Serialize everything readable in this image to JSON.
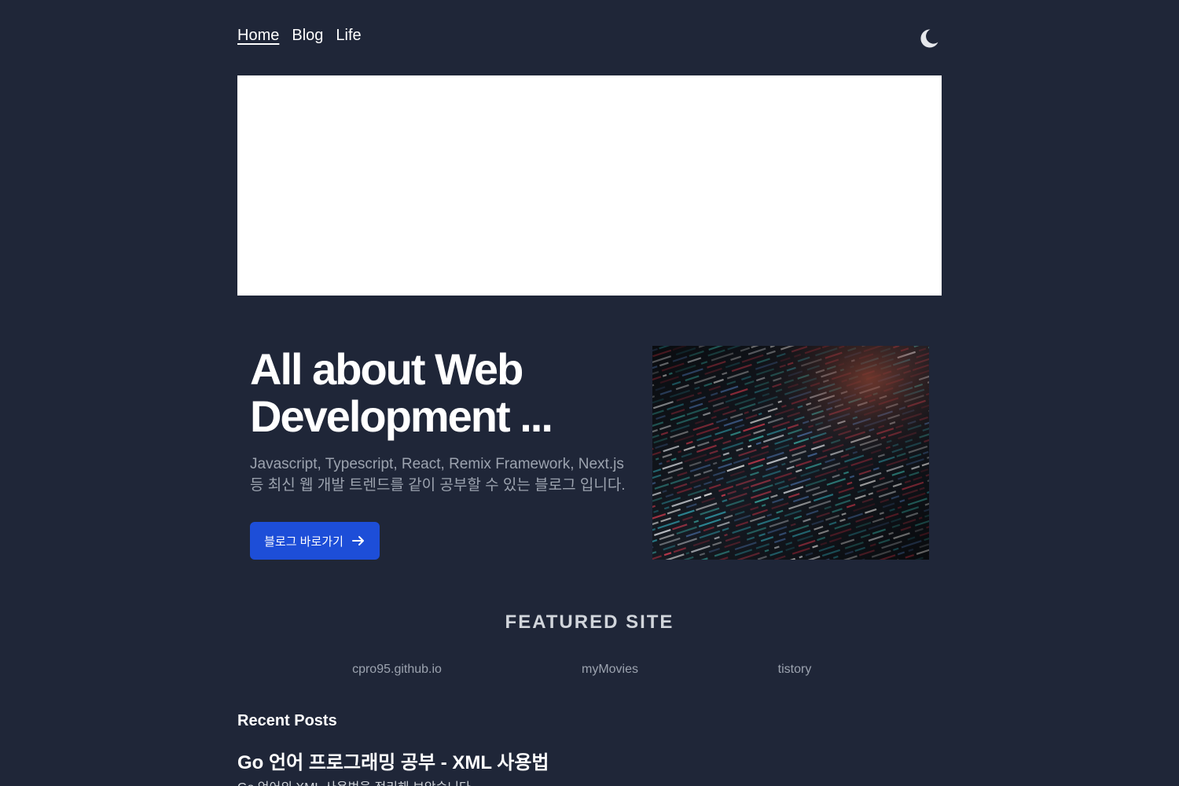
{
  "nav": {
    "items": [
      {
        "label": "Home",
        "active": true
      },
      {
        "label": "Blog",
        "active": false
      },
      {
        "label": "Life",
        "active": false
      }
    ],
    "theme_icon": "moon-icon"
  },
  "hero": {
    "title": "All about Web Development ...",
    "description_line1": "Javascript, Typescript, React, Remix Framework, Next.js",
    "description_line2": "등 최신 웹 개발 트렌드를 같이 공부할 수 있는 블로그 입니다.",
    "button_label": "블로그 바로가기",
    "button_icon": "arrow-right-icon",
    "image": "code-screen-image"
  },
  "featured": {
    "heading": "FEATURED SITE",
    "sites": [
      {
        "label": "cpro95.github.io"
      },
      {
        "label": "myMovies"
      },
      {
        "label": "tistory"
      }
    ]
  },
  "recent": {
    "label": "Recent Posts",
    "posts": [
      {
        "title": "Go 언어 프로그래밍 공부 - XML 사용법",
        "excerpt": "Go 언어의 XML 사용법을 정리해 보았습니다."
      }
    ]
  },
  "colors": {
    "background": "#1f2638",
    "accent": "#1d4ed8",
    "muted_text": "#9ca3af"
  }
}
